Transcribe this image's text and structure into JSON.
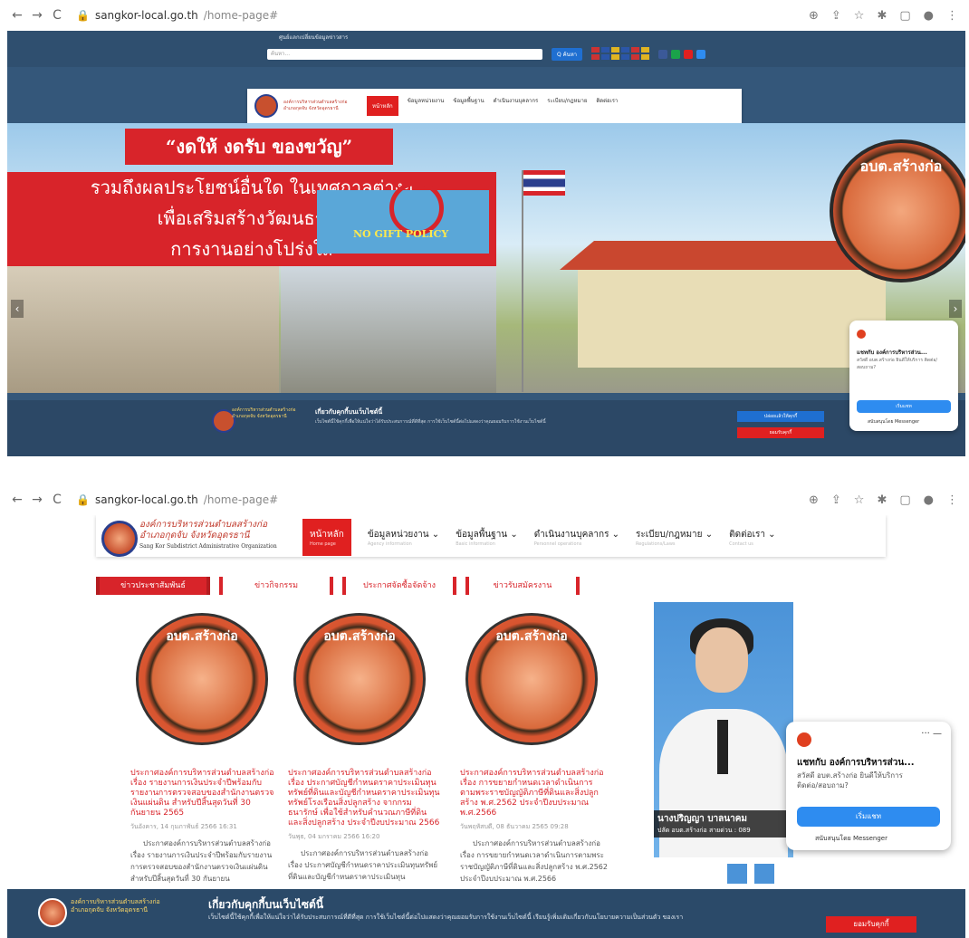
{
  "browser": {
    "domain": "sangkor-local.go.th",
    "path": "/home-page#",
    "back": "←",
    "forward": "→",
    "reload": "C",
    "lock": "🔒",
    "right_icons": [
      "⊕",
      "⇪",
      "☆",
      "✱",
      "▢",
      "●",
      "⋮"
    ]
  },
  "shot1": {
    "top_tiny": "ศูนย์แลกเปลี่ยนข้อมูลข่าวสาร",
    "search_placeholder": "ค้นหา...",
    "search_btn": "Q ค้นหา",
    "org_lines": [
      "องค์การบริหารส่วนตำบลสร้างก่อ",
      "อำเภอกุดจับ จังหวัดอุดรธานี"
    ],
    "menu": [
      "หน้าหลัก",
      "ข้อมูลหน่วยงาน",
      "ข้อมูลพื้นฐาน",
      "ดำเนินงานบุคลากร",
      "ระเบียบ/กฎหมาย",
      "ติดต่อเรา"
    ],
    "banner_title": "“งดให้ งดรับ ของขวัญ”",
    "banner_lines": [
      "รวมถึงผลประโยชน์อื่นใด ในเทศกาลต่างๆ",
      "เพื่อเสริมสร้างวัฒนธรรม",
      "การงานอย่างโปร่งใส"
    ],
    "no_gift": "NO GIFT POLICY",
    "emblem_text": "อบต.สร้างก่อ",
    "prev": "‹",
    "next": "›",
    "cookie_title": "เกี่ยวกับคุกกี้บนเว็บไซต์นี้",
    "cookie_text": "เว็บไซต์นี้ใช้คุกกี้เพื่อให้แน่ใจว่าได้รับประสบการณ์ที่ดีที่สุด การใช้เว็บไซต์นี้ต่อไปแสดงว่าคุณยอมรับการใช้งานเว็บไซต์นี้",
    "cookie_btn1": "ปล่อยแล้วให้คุกกี้",
    "cookie_btn2": "ยอมรับคุกกี้",
    "msg_title": "แชทกับ องค์การบริหารส่วน...",
    "msg_sub": "สวัสดี อบต.สร้างก่อ ยินดีให้บริการ ติดต่อ/สอบถาม?",
    "msg_btn": "เริ่มแชท",
    "msg_foot": "สนับสนุนโดย Messenger"
  },
  "shot2": {
    "org_l1": "องค์การบริหารส่วนตำบลสร้างก่อ",
    "org_l2": "อำเภอกุดจับ จังหวัดอุดรธานี",
    "org_l3": "Sang Kor Subdistrict Administrative Organization",
    "menu_active": "หน้าหลัก",
    "menu_active_sub": "Home page",
    "menu": [
      {
        "label": "ข้อมูลหน่วยงาน ⌄",
        "sub": "Agency information"
      },
      {
        "label": "ข้อมูลพื้นฐาน ⌄",
        "sub": "Basic information"
      },
      {
        "label": "ดำเนินงานบุคลากร ⌄",
        "sub": "Personnel operations"
      },
      {
        "label": "ระเบียบ/กฎหมาย ⌄",
        "sub": "Regulations/Laws"
      },
      {
        "label": "ติดต่อเรา ⌄",
        "sub": "Contact us"
      }
    ],
    "tabs": [
      "ข่าวประชาสัมพันธ์",
      "ข่าวกิจกรรม",
      "ประกาศจัดซื้อจัดจ้าง",
      "ข่าวรับสมัครงาน"
    ],
    "cards": [
      {
        "emblem": "อบต.สร้างก่อ",
        "title": "ประกาศองค์การบริหารส่วนตำบลสร้างก่อ เรื่อง รายงานการเงินประจำปีพร้อมกับรายงานการตรวจสอบของสำนักงานตรวจเงินแผ่นดิน สำหรับปีสิ้นสุดวันที่ 30 กันยายน 2565",
        "date": "วันอังคาร, 14 กุมภาพันธ์ 2566 16:31",
        "body": "ประกาศองค์การบริหารส่วนตำบลสร้างก่อ เรื่อง รายงานการเงินประจำปีพร้อมกับรายงานการตรวจสอบของสำนักงานตรวจเงินแผ่นดิน สำหรับปีสิ้นสุดวันที่ 30 กันยายน"
      },
      {
        "emblem": "อบต.สร้างก่อ",
        "title": "ประกาศองค์การบริหารส่วนตำบลสร้างก่อ เรื่อง ประกาศบัญชีกำหนดราคาประเมินทุนทรัพย์ที่ดินและบัญชีกำหนดราคาประเมินทุนทรัพย์โรงเรือนสิ่งปลูกสร้าง จากกรมธนารักษ์ เพื่อใช้สำหรับคำนวณภาษีที่ดินและสิ่งปลูกสร้าง ประจำปีงบประมาณ 2566",
        "date": "วันพุธ, 04 มกราคม 2566 16:20",
        "body": "ประกาศองค์การบริหารส่วนตำบลสร้างก่อ เรื่อง ประกาศบัญชีกำหนดราคาประเมินทุนทรัพย์ที่ดินและบัญชีกำหนดราคาประเมินทุน"
      },
      {
        "emblem": "อบต.สร้างก่อ",
        "title": "ประกาศองค์การบริหารส่วนตำบลสร้างก่อ เรื่อง การขยายกำหนดเวลาดำเนินการตามพระราชบัญญัติภาษีที่ดินและสิ่งปลูกสร้าง พ.ศ.2562 ประจำปีงบประมาณ พ.ศ.2566",
        "date": "วันพฤหัสบดี, 08 ธันวาคม 2565 09:28",
        "body": "ประกาศองค์การบริหารส่วนตำบลสร้างก่อ เรื่อง การขยายกำหนดเวลาดำเนินการตามพระราชบัญญัติภาษีที่ดินและสิ่งปลูกสร้าง พ.ศ.2562 ประจำปีงบประมาณ พ.ศ.2566"
      }
    ],
    "portrait_name": "นางปริญญา บาลนาคม",
    "portrait_role": "ปลัด อบต.สร้างก่อ สายด่วน : 089",
    "cookie_title": "เกี่ยวกับคุกกี้บนเว็บไซต์นี้",
    "cookie_text": "เว็บไซต์นี้ใช้คุกกี้เพื่อให้แน่ใจว่าได้รับประสบการณ์ที่ดีที่สุด การใช้เว็บไซต์นี้ต่อไปแสดงว่าคุณยอมรับการใช้งานเว็บไซต์นี้ เรียนรู้เพิ่มเติมเกี่ยวกับนโยบายความเป็นส่วนตัว ของเรา",
    "cookie_btn": "ยอมรับคุกกี้",
    "msg_tools": "···  —",
    "msg_title": "แชทกับ องค์การบริหารส่วน...",
    "msg_sub": "สวัสดี อบต.สร้างก่อ ยินดีให้บริการ ติดต่อ/สอบถาม?",
    "msg_btn": "เริ่มแชท",
    "msg_foot": "สนับสนุนโดย Messenger"
  }
}
